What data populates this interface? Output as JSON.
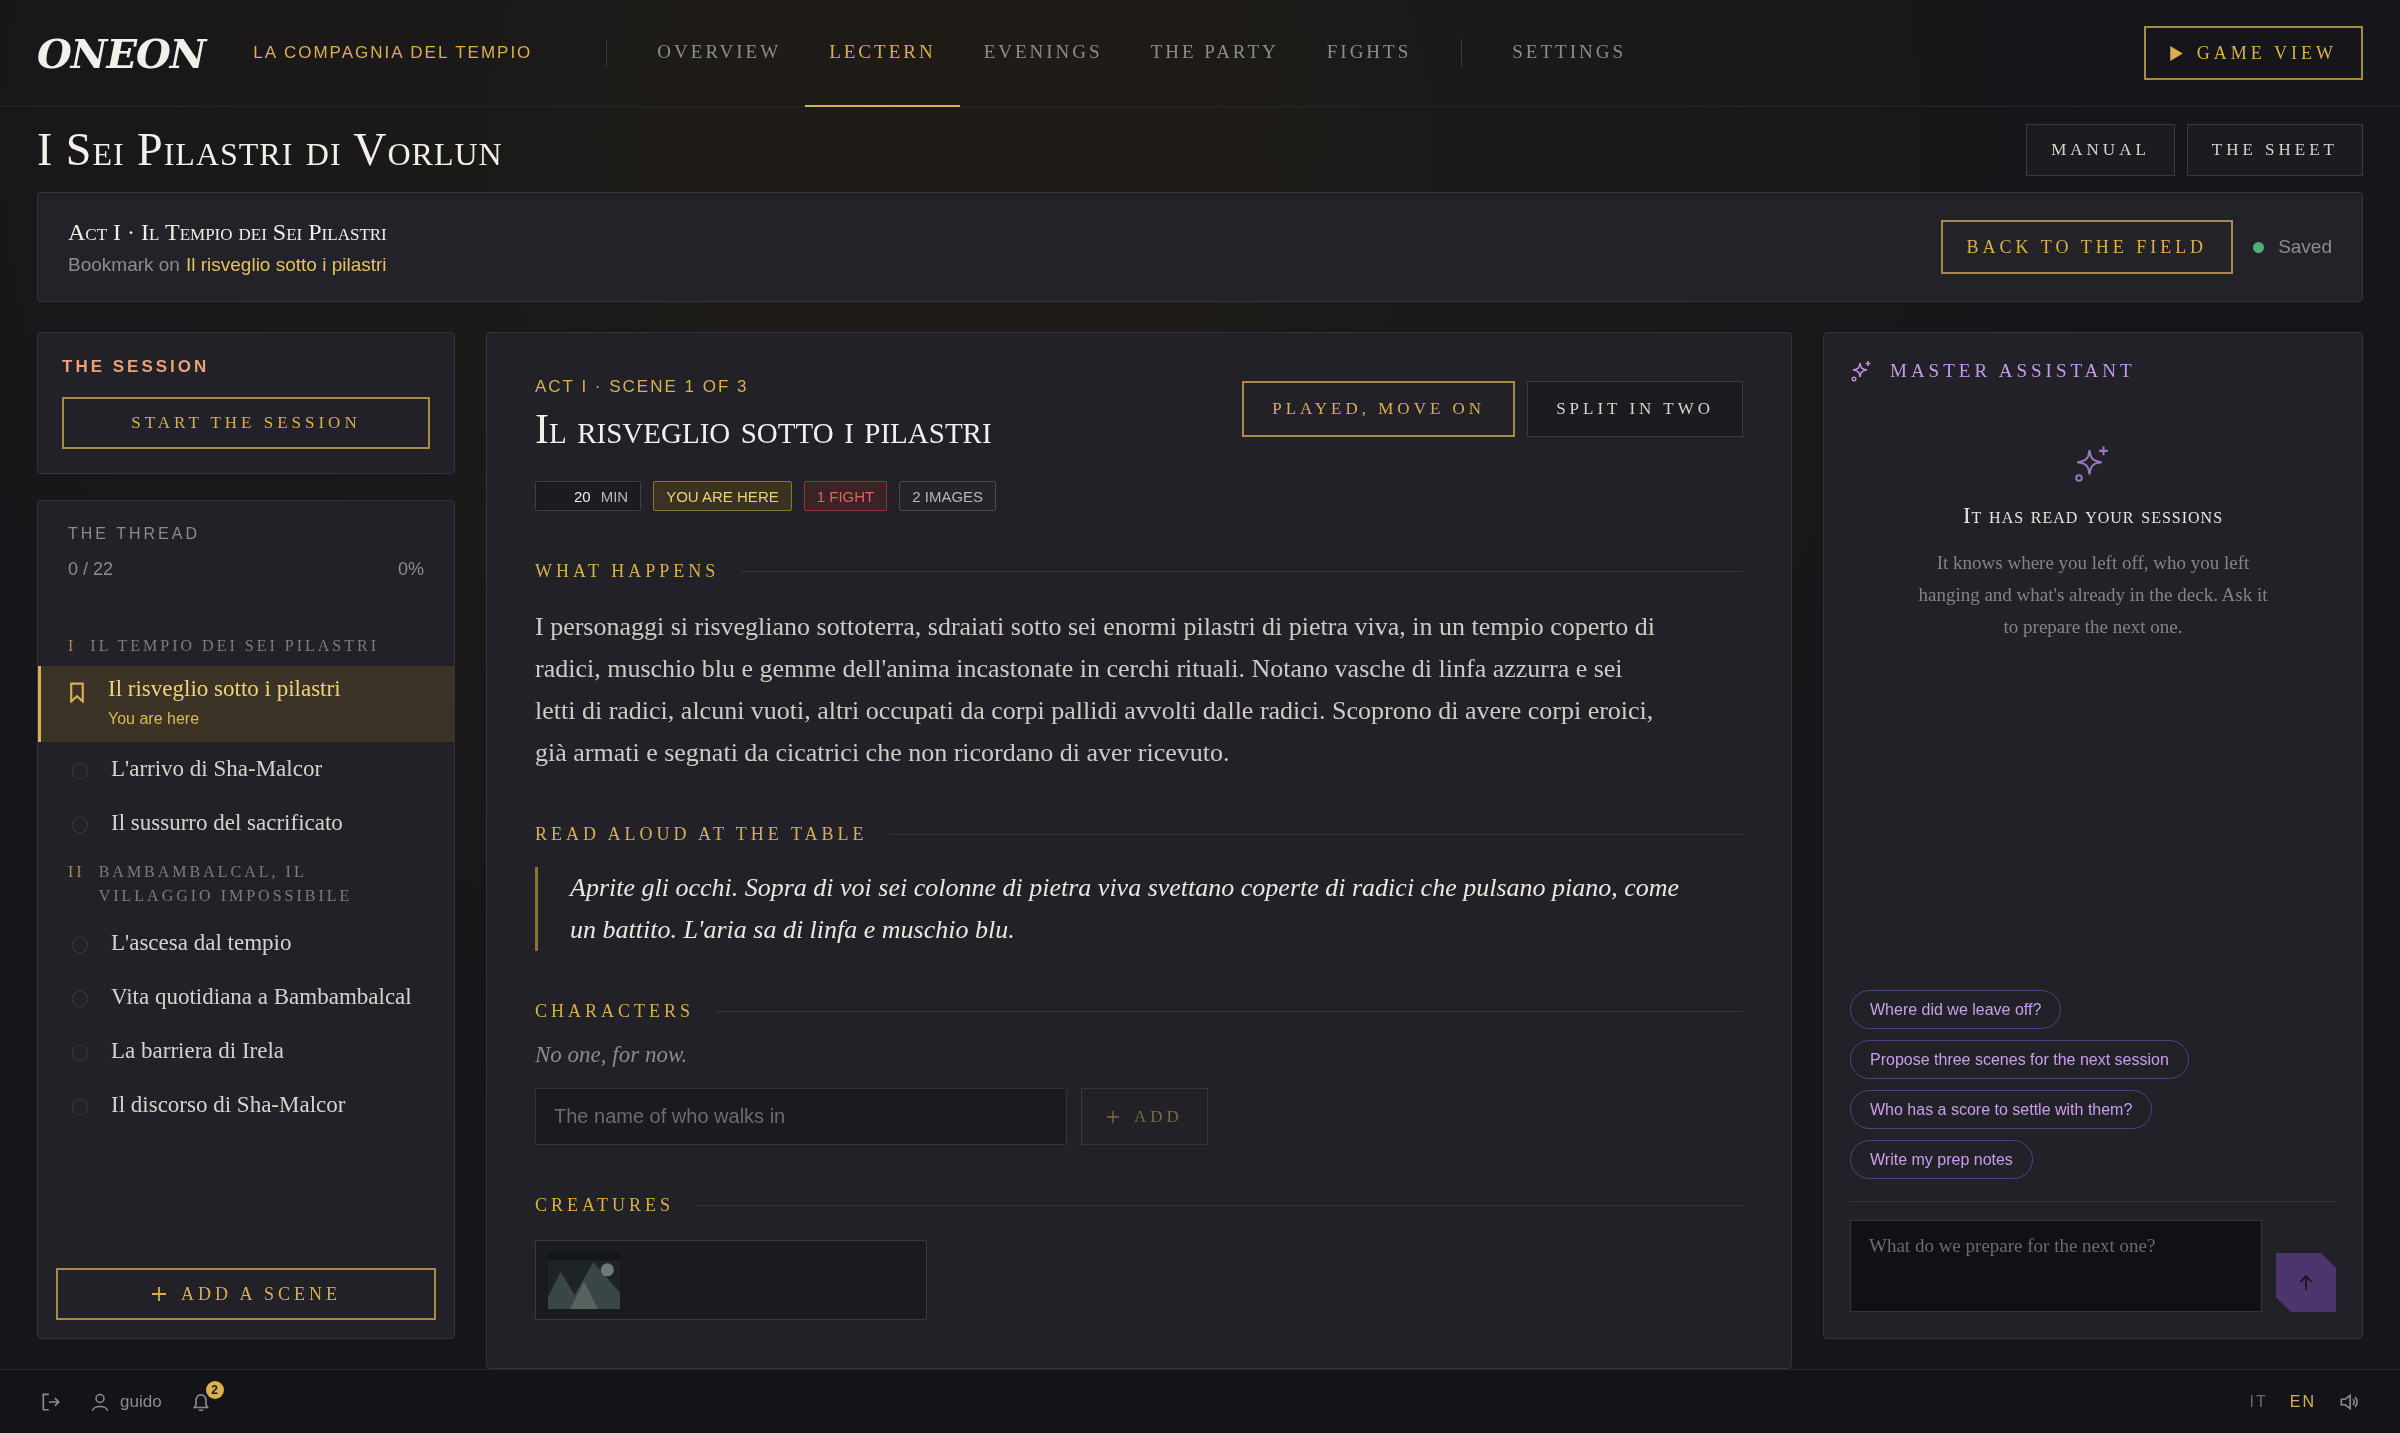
{
  "brand": {
    "logo": "ONEON",
    "campaign": "LA COMPAGNIA DEL TEMPIO"
  },
  "nav": {
    "main": [
      {
        "label": "OVERVIEW",
        "selected": false
      },
      {
        "label": "LECTERN",
        "selected": true
      },
      {
        "label": "EVENINGS",
        "selected": false
      },
      {
        "label": "THE PARTY",
        "selected": false
      },
      {
        "label": "FIGHTS",
        "selected": false
      }
    ],
    "extra": [
      {
        "label": "SETTINGS",
        "selected": false
      }
    ]
  },
  "game_view_button": "GAME VIEW",
  "page_title": "I Sei Pilastri di Vorlun",
  "header_buttons": [
    "MANUAL",
    "THE SHEET"
  ],
  "act_bar": {
    "title": "Act I · Il Tempio dei Sei Pilastri",
    "bookmark_prefix": "Bookmark on",
    "bookmark_link": "Il risveglio sotto i pilastri",
    "back_button": "BACK TO THE FIELD",
    "status": "Saved"
  },
  "session": {
    "heading": "THE SESSION",
    "start_button": "START THE SESSION"
  },
  "thread": {
    "heading": "THE THREAD",
    "count": "0 / 22",
    "percent": "0%",
    "acts": [
      {
        "numeral": "I",
        "title": "IL TEMPIO DEI SEI PILASTRI",
        "scenes": [
          {
            "title": "Il risveglio sotto i pilastri",
            "selected": true,
            "note": "You are here"
          },
          {
            "title": "L'arrivo di Sha-Malcor",
            "selected": false
          },
          {
            "title": "Il sussurro del sacrificato",
            "selected": false
          }
        ]
      },
      {
        "numeral": "II",
        "title": "BAMBAMBALCAL, IL VILLAGGIO IMPOSSIBILE",
        "scenes": [
          {
            "title": "L'ascesa dal tempio",
            "selected": false
          },
          {
            "title": "Vita quotidiana a Bambambalcal",
            "selected": false
          },
          {
            "title": "La barriera di Irela",
            "selected": false
          },
          {
            "title": "Il discorso di Sha-Malcor",
            "selected": false
          }
        ]
      }
    ],
    "add_button": "ADD A SCENE"
  },
  "scene": {
    "eyebrow": "ACT I · SCENE 1 OF 3",
    "title": "Il risveglio sotto i pilastri",
    "actions": [
      {
        "label": "PLAYED, MOVE ON",
        "kind": "primary"
      },
      {
        "label": "SPLIT IN TWO",
        "kind": "secondary"
      }
    ],
    "tags": [
      {
        "kind": "duration",
        "value": "20",
        "unit": "MIN"
      },
      {
        "kind": "current",
        "label": "YOU ARE HERE"
      },
      {
        "kind": "fight",
        "label": "1 FIGHT"
      },
      {
        "kind": "plain",
        "label": "2 IMAGES"
      }
    ],
    "what_happens": {
      "heading": "WHAT HAPPENS",
      "text": "I personaggi si risvegliano sottoterra, sdraiati sotto sei enormi pilastri di pietra viva, in un tempio coperto di radici, muschio blu e gemme dell'anima incastonate in cerchi rituali. Notano vasche di linfa azzurra e sei letti di radici, alcuni vuoti, altri occupati da corpi pallidi avvolti dalle radici. Scoprono di avere corpi eroici, già armati e segnati da cicatrici che non ricordano di aver ricevuto."
    },
    "read_aloud": {
      "heading": "READ ALOUD AT THE TABLE",
      "text": "Aprite gli occhi. Sopra di voi sei colonne di pietra viva svettano coperte di radici che pulsano piano, come un battito. L'aria sa di linfa e muschio blu."
    },
    "characters": {
      "heading": "CHARACTERS",
      "empty": "No one, for now.",
      "placeholder": "The name of who walks in",
      "add_button": "ADD"
    },
    "creatures": {
      "heading": "CREATURES"
    }
  },
  "assistant": {
    "title": "MASTER ASSISTANT",
    "empty_title": "It has read your sessions",
    "empty_text": "It knows where you left off, who you left hanging and what's already in the deck. Ask it to prepare the next one.",
    "suggestions": [
      "Where did we leave off?",
      "Propose three scenes for the next session",
      "Who has a score to settle with them?",
      "Write my prep notes"
    ],
    "placeholder": "What do we prepare for the next one?"
  },
  "footer": {
    "user": "guido",
    "notifications": "2",
    "languages": [
      {
        "label": "IT",
        "selected": false
      },
      {
        "label": "EN",
        "selected": true
      }
    ]
  }
}
